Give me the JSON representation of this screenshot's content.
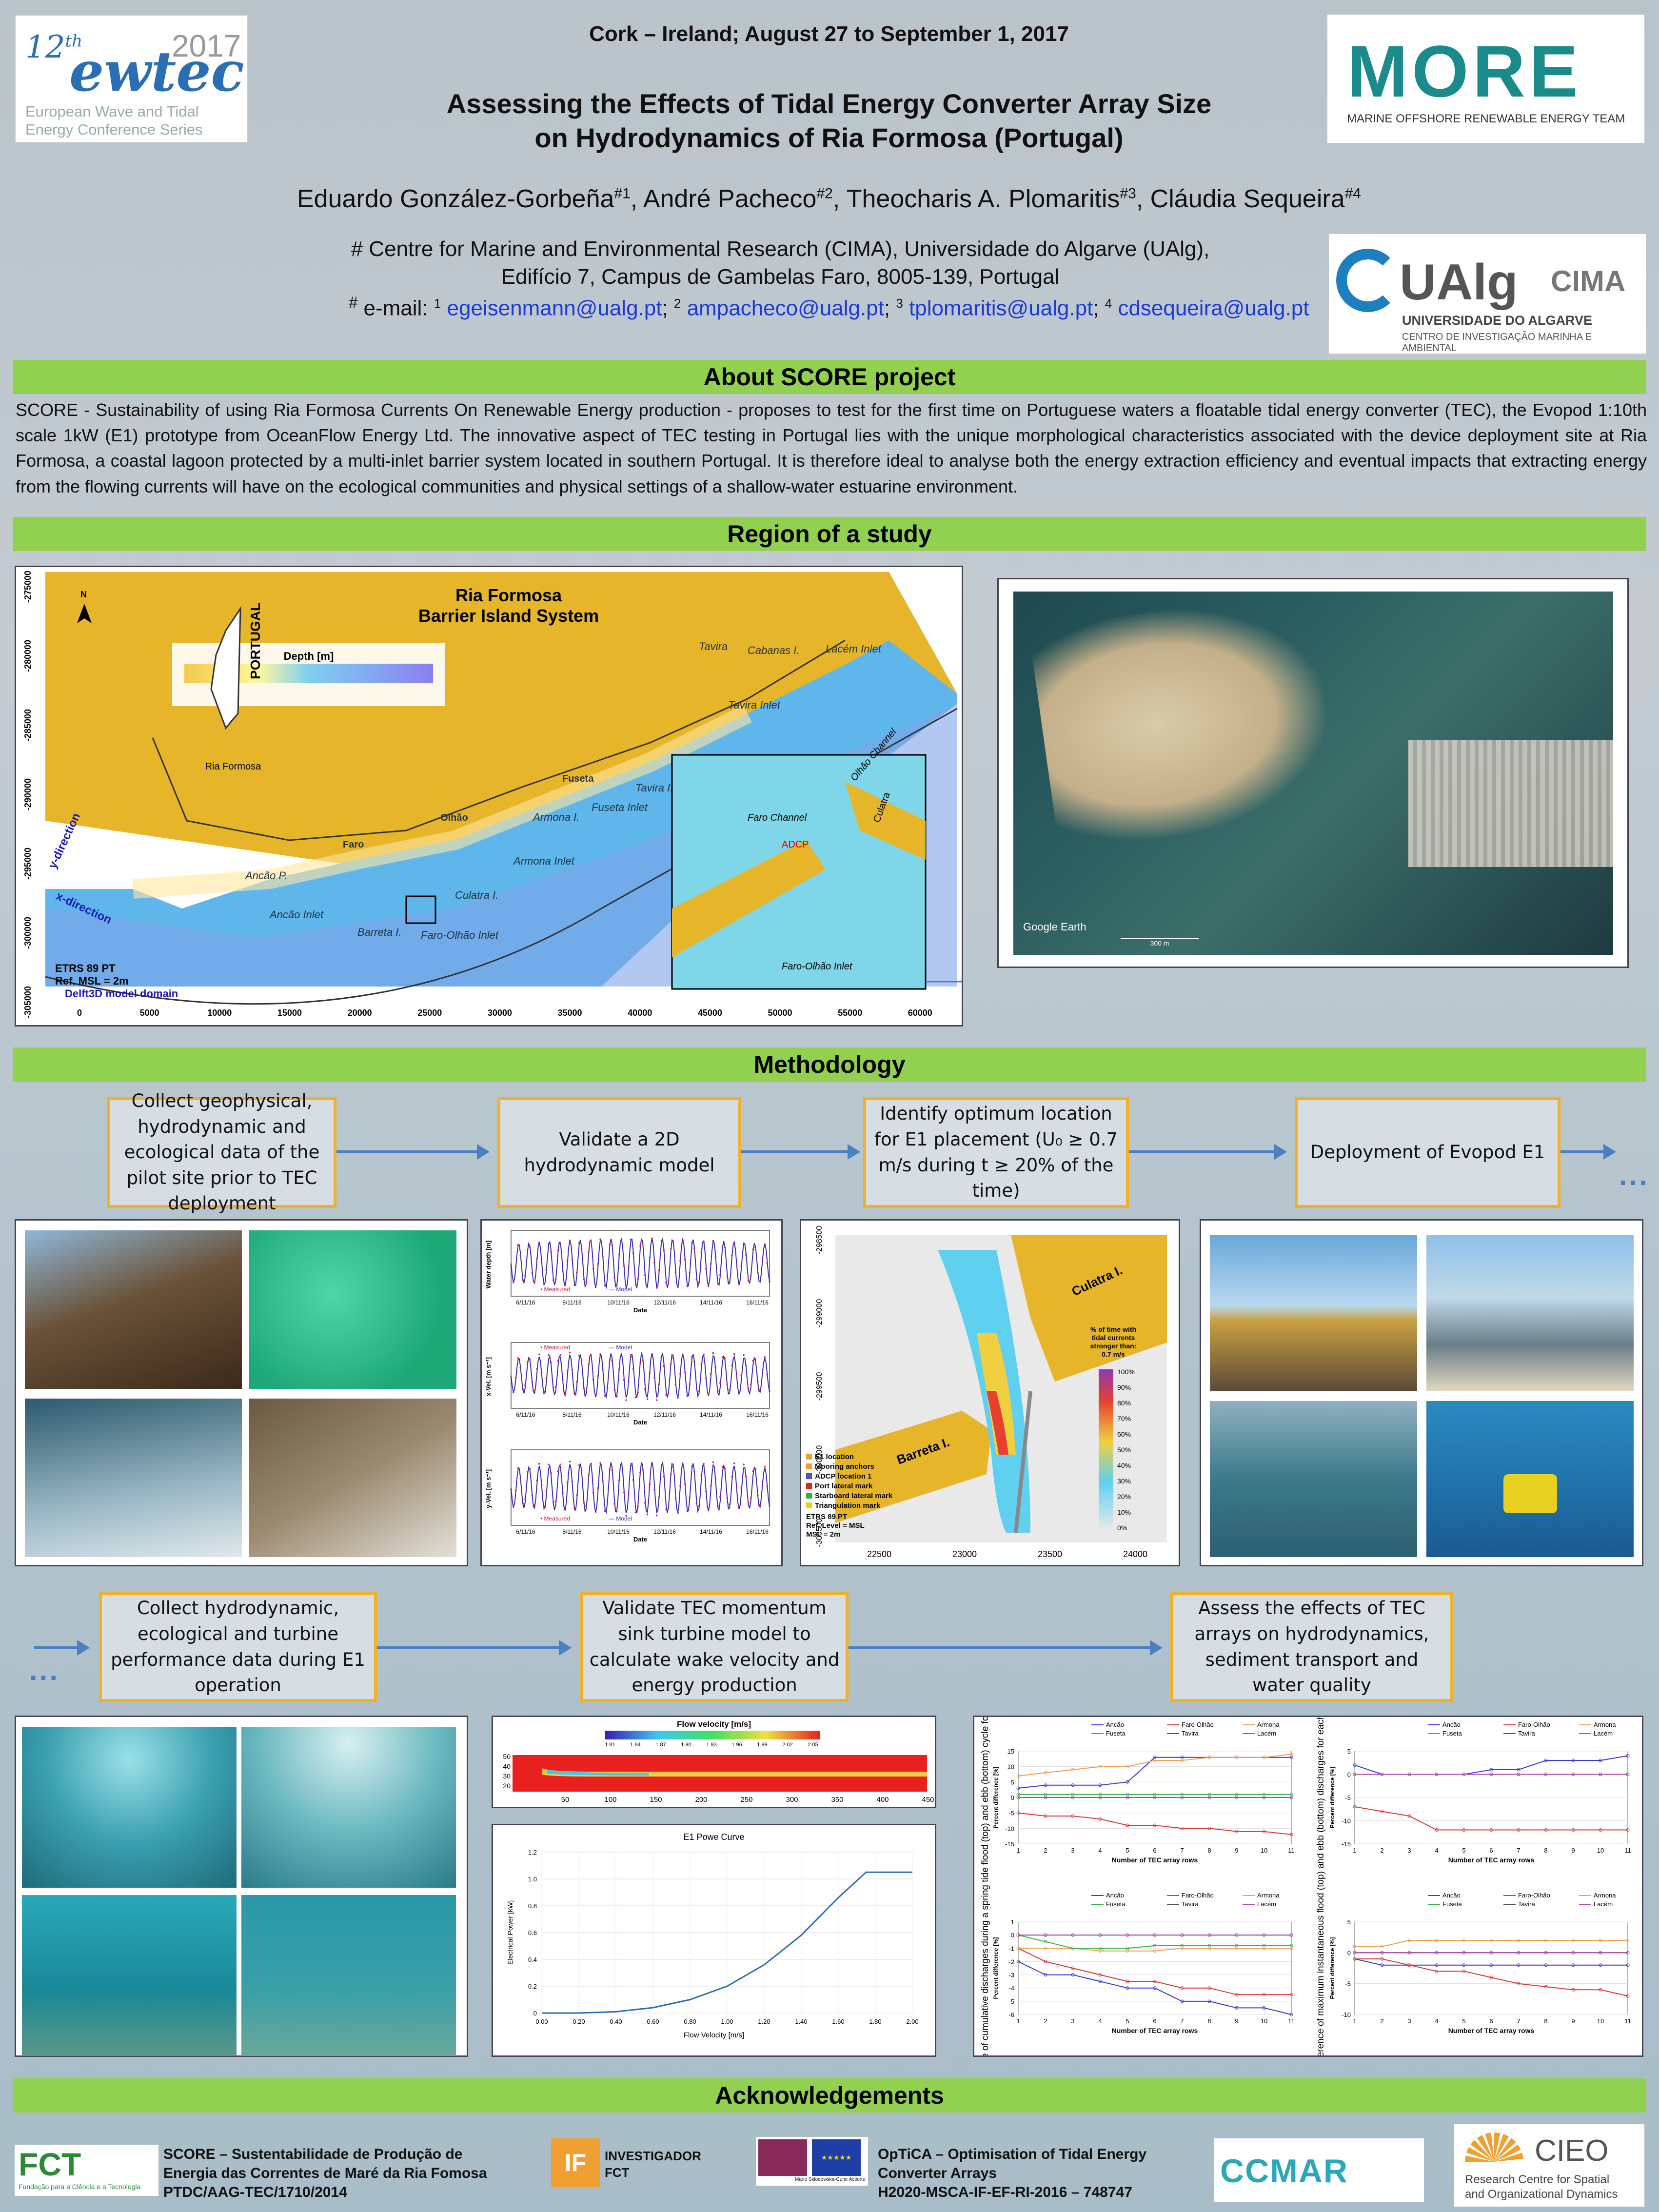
{
  "header": {
    "conf_number": "12",
    "conf_number_sup": "th",
    "conf_acronym": "ewtec",
    "conf_year": "2017",
    "conf_sub": "European Wave and Tidal Energy Conference Series",
    "location_date": "Cork – Ireland; August 27 to September 1, 2017",
    "title_line1": "Assessing the Effects of Tidal Energy Converter Array Size",
    "title_line2": "on Hydrodynamics of Ria Formosa (Portugal)",
    "authors": [
      {
        "name": "Eduardo González-Gorbeña",
        "sup": "#1"
      },
      {
        "name": "André Pacheco",
        "sup": "#2"
      },
      {
        "name": "Theocharis A. Plomaritis",
        "sup": "#3"
      },
      {
        "name": "Cláudia Sequeira",
        "sup": "#4"
      }
    ],
    "affil_line1": "# Centre for Marine and Environmental Research (CIMA), Universidade do Algarve (UAlg),",
    "affil_line2": "Edifício 7, Campus de Gambelas Faro, 8005-139, Portugal",
    "email_label": "e-mail:",
    "emails": [
      "egeisenmann@ualg.pt",
      "ampacheco@ualg.pt",
      "tplomaritis@ualg.pt",
      "cdsequeira@ualg.pt"
    ],
    "more_logo": "MORE",
    "more_sub": "MARINE OFFSHORE RENEWABLE ENERGY TEAM",
    "ualg_logo": "UAlg",
    "cima_logo": "CIMA",
    "ualg_sub1": "UNIVERSIDADE DO ALGARVE",
    "ualg_sub2": "CENTRO DE INVESTIGAÇÃO MARINHA E AMBIENTAL"
  },
  "about": {
    "heading": "About SCORE project",
    "text": "SCORE - Sustainability of using Ria Formosa Currents On Renewable Energy production - proposes to test for the first time on Portuguese waters a floatable tidal energy converter (TEC), the Evopod 1:10th scale 1kW (E1) prototype from OceanFlow Energy Ltd. The innovative aspect of TEC testing in Portugal lies with the unique morphological characteristics associated with the device deployment site at Ria Formosa, a coastal lagoon protected by a multi-inlet barrier system located in southern Portugal. It is therefore ideal to analyse both the energy extraction efficiency and eventual impacts that extracting energy from the flowing currents will have on the ecological communities and physical settings of a shallow-water estuarine environment."
  },
  "region": {
    "heading": "Region of a study",
    "map_title1": "Ria Formosa",
    "map_title2": "Barrier Island System",
    "depth_label": "Depth [m]",
    "portugal": "PORTUGAL",
    "ria_formosa": "Ria Formosa",
    "place_labels": [
      "Tavira",
      "Cabanas I.",
      "Lacém Inlet",
      "Tavira Inlet",
      "Fuseta",
      "Tavira I.",
      "Fuseta Inlet",
      "Olhão",
      "Armona I.",
      "Faro",
      "Armona Inlet",
      "Ancão P.",
      "Culatra I.",
      "Ancão Inlet",
      "Barreta I.",
      "Faro-Olhão Inlet"
    ],
    "axis_x_dir": "x-direction",
    "axis_y_dir": "y-direction",
    "legend": [
      "ETRS 89 PT",
      "Ref. MSL = 2m",
      "Delft3D model domain"
    ],
    "x_ticks": [
      "0",
      "5000",
      "10000",
      "15000",
      "20000",
      "25000",
      "30000",
      "35000",
      "40000",
      "45000",
      "50000",
      "55000",
      "60000"
    ],
    "y_ticks": [
      "-275000",
      "-280000",
      "-285000",
      "-290000",
      "-295000",
      "-300000",
      "-305000"
    ],
    "inset_labels": [
      "Faro Channel",
      "Olhão Channel",
      "Culatra",
      "ADCP",
      "Faro-Olhão Inlet"
    ],
    "ge_label": "Google Earth",
    "ge_scale": "300 m"
  },
  "methodology": {
    "heading": "Methodology",
    "steps_row1": [
      "Collect geophysical, hydrodynamic and ecological data of the pilot site prior to TEC deployment",
      "Validate a 2D hydrodynamic model",
      "Identify optimum location for E1 placement (U₀ ≥ 0.7 m/s during t ≥ 20% of the time)",
      "Deployment of Evopod E1"
    ],
    "steps_row2": [
      "Collect hydrodynamic, ecological and turbine performance data during E1 operation",
      "Validate TEC momentum sink turbine model to calculate wake velocity and energy production",
      "Assess the effects of TEC arrays on hydrodynamics, sediment transport and water quality"
    ],
    "dots": "...",
    "validation": {
      "ylabels": [
        "Water depth [m]",
        "x-Vel. [m s⁻¹]",
        "y-Vel. [m s⁻¹]"
      ],
      "xticks": [
        "6/11/16",
        "8/11/16",
        "10/11/16",
        "12/11/16",
        "14/11/16",
        "16/11/16"
      ],
      "xlabel": "Date",
      "legend": [
        "Measured",
        "Model"
      ]
    },
    "currents_map": {
      "legend_title": "% of time with tidal currents stronger than: 0.7 m/s",
      "pct_ticks": [
        "100%",
        "90%",
        "80%",
        "70%",
        "60%",
        "50%",
        "40%",
        "30%",
        "20%",
        "10%",
        "0%"
      ],
      "labels": [
        "Culatra I.",
        "Barreta I."
      ],
      "legend": [
        "E1 location",
        "Mooring anchors",
        "ADCP location 1",
        "Port lateral mark",
        "Starboard lateral mark",
        "Triangulation mark"
      ],
      "ref": [
        "ETRS 89 PT",
        "Ref. Level = MSL",
        "MSL = 2m"
      ],
      "x_ticks": [
        "22500",
        "23000",
        "23500",
        "24000"
      ],
      "y_ticks": [
        "-298500",
        "-299000",
        "-299500",
        "-300000",
        "-300500"
      ]
    },
    "flow_velocity": {
      "title": "Flow velocity [m/s]",
      "cbar": [
        "1.81",
        "1.84",
        "1.87",
        "1.90",
        "1.93",
        "1.96",
        "1.99",
        "2.02",
        "2.05"
      ],
      "y_ticks": [
        "50",
        "40",
        "30",
        "20"
      ],
      "x_ticks": [
        "50",
        "100",
        "150",
        "200",
        "250",
        "300",
        "350",
        "400",
        "450"
      ]
    },
    "power_curve": {
      "type": "line",
      "title": "E1 Powe Curve",
      "xlabel": "Flow Velocity [m/s]",
      "ylabel": "Electrical Power [kW]",
      "x": [
        0.0,
        0.2,
        0.4,
        0.6,
        0.8,
        1.0,
        1.2,
        1.4,
        1.6,
        1.75,
        2.0
      ],
      "y": [
        0.0,
        0.0,
        0.01,
        0.04,
        0.1,
        0.2,
        0.36,
        0.58,
        0.86,
        1.05,
        1.05
      ],
      "xlim": [
        0,
        2
      ],
      "ylim": [
        0,
        1.2
      ],
      "x_ticks": [
        "0.00",
        "0.20",
        "0.40",
        "0.60",
        "0.80",
        "1.00",
        "1.20",
        "1.40",
        "1.60",
        "1.80",
        "2.00"
      ],
      "y_ticks": [
        "0",
        "0.2",
        "0.4",
        "0.6",
        "0.8",
        "1.0",
        "1.2"
      ]
    }
  },
  "chart_data": [
    {
      "type": "line",
      "panel": "cumulative flood",
      "xlabel": "Number of TEC array rows",
      "ylabel": "Percent difference [%]",
      "ylim": [
        -15,
        15
      ],
      "x": [
        1,
        2,
        3,
        4,
        5,
        6,
        7,
        8,
        9,
        10,
        11
      ],
      "series": [
        {
          "name": "Ancão",
          "color": "#3a3ad8",
          "values": [
            3,
            4,
            4,
            4,
            5,
            13,
            13,
            13,
            13,
            13,
            13
          ]
        },
        {
          "name": "Faro-Olhão",
          "color": "#d83a3a",
          "values": [
            -5,
            -6,
            -6,
            -7,
            -9,
            -9,
            -10,
            -10,
            -11,
            -11,
            -12
          ]
        },
        {
          "name": "Armona",
          "color": "#f0a050",
          "values": [
            7,
            8,
            9,
            10,
            10,
            12,
            12,
            13,
            13,
            13,
            14
          ]
        },
        {
          "name": "Fuseta",
          "color": "#3ab04a",
          "values": [
            1,
            1,
            1,
            1,
            1,
            1,
            1,
            1,
            1,
            1,
            1
          ]
        },
        {
          "name": "Tavira",
          "color": "#555",
          "values": [
            0,
            0,
            0,
            0,
            0,
            0,
            0,
            0,
            0,
            0,
            0
          ]
        },
        {
          "name": "Lacém",
          "color": "#b04ab0",
          "values": [
            0,
            0,
            0,
            0,
            0,
            0,
            0,
            0,
            0,
            0,
            0
          ]
        }
      ]
    },
    {
      "type": "line",
      "panel": "cumulative ebb",
      "xlabel": "Number of TEC array rows",
      "ylabel": "Percent difference [%]",
      "ylim": [
        -6,
        1
      ],
      "x": [
        1,
        2,
        3,
        4,
        5,
        6,
        7,
        8,
        9,
        10,
        11
      ],
      "series": [
        {
          "name": "Ancão",
          "color": "#3a3ad8",
          "values": [
            -2,
            -3,
            -3,
            -3.5,
            -4,
            -4,
            -5,
            -5,
            -5.5,
            -5.5,
            -6
          ]
        },
        {
          "name": "Faro-Olhão",
          "color": "#d83a3a",
          "values": [
            -1,
            -2,
            -2.5,
            -3,
            -3.5,
            -3.5,
            -4,
            -4,
            -4.5,
            -4.5,
            -4.5
          ]
        },
        {
          "name": "Armona",
          "color": "#f0a050",
          "values": [
            -1,
            -1,
            -1,
            -1.2,
            -1.2,
            -1.2,
            -1,
            -1,
            -1,
            -1,
            -1
          ]
        },
        {
          "name": "Fuseta",
          "color": "#3ab04a",
          "values": [
            0,
            -0.5,
            -1,
            -1,
            -1,
            -0.8,
            -0.8,
            -0.8,
            -0.8,
            -0.8,
            -0.8
          ]
        },
        {
          "name": "Tavira",
          "color": "#555",
          "values": [
            0,
            0,
            0,
            0,
            0,
            0,
            0,
            0,
            0,
            0,
            0
          ]
        },
        {
          "name": "Lacém",
          "color": "#b04ab0",
          "values": [
            0,
            0,
            0,
            0,
            0,
            0,
            0,
            0,
            0,
            0,
            0
          ]
        }
      ]
    },
    {
      "type": "line",
      "panel": "instantaneous flood",
      "xlabel": "Number of TEC array rows",
      "ylabel": "Percent difference [%]",
      "ylim": [
        -15,
        5
      ],
      "x": [
        1,
        2,
        3,
        4,
        5,
        6,
        7,
        8,
        9,
        10,
        11
      ],
      "series": [
        {
          "name": "Ancão",
          "color": "#3a3ad8",
          "values": [
            2,
            0,
            0,
            0,
            0,
            1,
            1,
            3,
            3,
            3,
            4
          ]
        },
        {
          "name": "Faro-Olhão",
          "color": "#d83a3a",
          "values": [
            -7,
            -8,
            -9,
            -12,
            -12,
            -12,
            -12,
            -12,
            -12,
            -12,
            -12
          ]
        },
        {
          "name": "Armona",
          "color": "#f0a050",
          "values": [
            0,
            0,
            0,
            0,
            0,
            0,
            0,
            0,
            0,
            0,
            0
          ]
        },
        {
          "name": "Fuseta",
          "color": "#3ab04a",
          "values": [
            0,
            0,
            0,
            0,
            0,
            0,
            0,
            0,
            0,
            0,
            0
          ]
        },
        {
          "name": "Tavira",
          "color": "#555",
          "values": [
            0,
            0,
            0,
            0,
            0,
            0,
            0,
            0,
            0,
            0,
            0
          ]
        },
        {
          "name": "Lacém",
          "color": "#b04ab0",
          "values": [
            0,
            0,
            0,
            0,
            0,
            0,
            0,
            0,
            0,
            0,
            0
          ]
        }
      ]
    },
    {
      "type": "line",
      "panel": "instantaneous ebb",
      "xlabel": "Number of TEC array rows",
      "ylabel": "Percent difference [%]",
      "ylim": [
        -10,
        5
      ],
      "x": [
        1,
        2,
        3,
        4,
        5,
        6,
        7,
        8,
        9,
        10,
        11
      ],
      "series": [
        {
          "name": "Ancão",
          "color": "#3a3ad8",
          "values": [
            -1,
            -2,
            -2,
            -2,
            -2,
            -2,
            -2,
            -2,
            -2,
            -2,
            -2
          ]
        },
        {
          "name": "Faro-Olhão",
          "color": "#d83a3a",
          "values": [
            -1,
            -1,
            -2,
            -3,
            -3,
            -4,
            -5,
            -5.5,
            -6,
            -6,
            -7
          ]
        },
        {
          "name": "Armona",
          "color": "#f0a050",
          "values": [
            1,
            1,
            2,
            2,
            2,
            2,
            2,
            2,
            2,
            2,
            2
          ]
        },
        {
          "name": "Fuseta",
          "color": "#3ab04a",
          "values": [
            0,
            0,
            0,
            0,
            0,
            0,
            0,
            0,
            0,
            0,
            0
          ]
        },
        {
          "name": "Tavira",
          "color": "#555",
          "values": [
            0,
            0,
            0,
            0,
            0,
            0,
            0,
            0,
            0,
            0,
            0
          ]
        },
        {
          "name": "Lacém",
          "color": "#b04ab0",
          "values": [
            0,
            0,
            0,
            0,
            0,
            0,
            0,
            0,
            0,
            0,
            0
          ]
        }
      ]
    }
  ],
  "results_labels": {
    "left_ylabel": "% difference of cumulative discharges during a spring tide flood (top) and ebb (bottom) cycle for each inlet.",
    "right_ylabel": "% difference of maximum instantaneous flood (top) and ebb (bottom) discharges for each inlet.",
    "xlabel": "Number of TEC array rows",
    "panel_ylabel": "Percent difference [%]"
  },
  "acknowledgements": {
    "heading": "Acknowledgements",
    "fct_logo": "FCT",
    "fct_sub": "Fundação para a Ciência e a Tecnologia",
    "score_text": [
      "SCORE – Sustentabilidade de Produção de",
      "Energia das   Correntes de Maré da Ria Fomosa",
      "PTDC/AAG-TEC/1710/2014"
    ],
    "if_logo": "IF",
    "if_text": [
      "INVESTIGADOR",
      "FCT"
    ],
    "msca": "Marie Skłodowska-Curie Actions",
    "optica_text": [
      "OpTiCA – Optimisation of Tidal Energy",
      "Converter Arrays",
      "H2020-MSCA-IF-EF-RI-2016 – 748747"
    ],
    "ccmar_logo": "CCMAR",
    "cieo_logo": "CIEO",
    "cieo_sub": [
      "Research Centre for Spatial",
      "and Organizational Dynamics"
    ]
  }
}
